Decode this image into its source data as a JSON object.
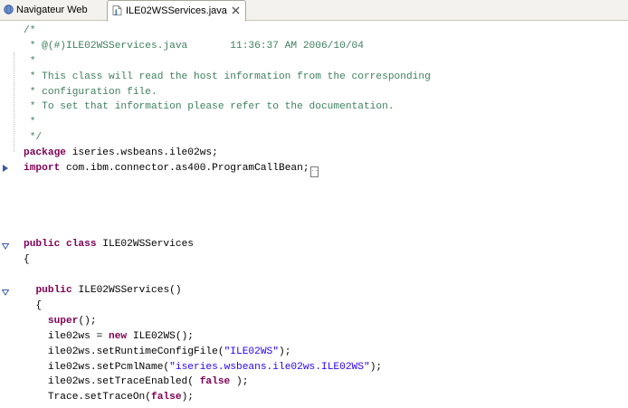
{
  "tabs": [
    {
      "label": "Navigateur Web",
      "icon": "globe-icon",
      "active": false
    },
    {
      "label": "ILE02WSServices.java",
      "icon": "java-file-icon",
      "active": true
    }
  ],
  "code": {
    "lines": [
      {
        "segs": [
          {
            "t": "/*",
            "c": "cm"
          }
        ]
      },
      {
        "segs": [
          {
            "t": " * @(#)ILE02WSServices.java       11:36:37 AM 2006/10/04",
            "c": "cm"
          }
        ]
      },
      {
        "segs": [
          {
            "t": " *",
            "c": "cm"
          }
        ]
      },
      {
        "segs": [
          {
            "t": " * This class will read the host information from the corresponding",
            "c": "cm"
          }
        ]
      },
      {
        "segs": [
          {
            "t": " * configuration file.",
            "c": "cm"
          }
        ]
      },
      {
        "segs": [
          {
            "t": " * To set that information please refer to the documentation.",
            "c": "cm"
          }
        ]
      },
      {
        "segs": [
          {
            "t": " *",
            "c": "cm"
          }
        ]
      },
      {
        "segs": [
          {
            "t": " */",
            "c": "cm"
          }
        ]
      },
      {
        "segs": [
          {
            "t": "package",
            "c": "kw"
          },
          {
            "t": " iseries.wsbeans.ile02ws;",
            "c": ""
          }
        ]
      },
      {
        "segs": [
          {
            "t": "import",
            "c": "kw"
          },
          {
            "t": " com.ibm.connector.as400.ProgramCallBean;",
            "c": ""
          }
        ],
        "collapsed": true
      },
      {
        "segs": []
      },
      {
        "segs": []
      },
      {
        "segs": []
      },
      {
        "segs": []
      },
      {
        "segs": [
          {
            "t": "public class",
            "c": "kw"
          },
          {
            "t": " ILE02WSServices",
            "c": ""
          }
        ]
      },
      {
        "segs": [
          {
            "t": "{",
            "c": ""
          }
        ]
      },
      {
        "segs": []
      },
      {
        "segs": [
          {
            "t": "  ",
            "c": ""
          },
          {
            "t": "public",
            "c": "kw"
          },
          {
            "t": " ILE02WSServices()",
            "c": ""
          }
        ]
      },
      {
        "segs": [
          {
            "t": "  {",
            "c": ""
          }
        ]
      },
      {
        "segs": [
          {
            "t": "    ",
            "c": ""
          },
          {
            "t": "super",
            "c": "kw"
          },
          {
            "t": "();",
            "c": ""
          }
        ]
      },
      {
        "segs": [
          {
            "t": "    ile02ws = ",
            "c": ""
          },
          {
            "t": "new",
            "c": "kw"
          },
          {
            "t": " ILE02WS();",
            "c": ""
          }
        ]
      },
      {
        "segs": [
          {
            "t": "    ile02ws.setRuntimeConfigFile(",
            "c": ""
          },
          {
            "t": "\"ILE02WS\"",
            "c": "str"
          },
          {
            "t": ");",
            "c": ""
          }
        ]
      },
      {
        "segs": [
          {
            "t": "    ile02ws.setPcmlName(",
            "c": ""
          },
          {
            "t": "\"iseries.wsbeans.ile02ws.ILE02WS\"",
            "c": "str"
          },
          {
            "t": ");",
            "c": ""
          }
        ]
      },
      {
        "segs": [
          {
            "t": "    ile02ws.setTraceEnabled( ",
            "c": ""
          },
          {
            "t": "false",
            "c": "kw"
          },
          {
            "t": " );",
            "c": ""
          }
        ]
      },
      {
        "segs": [
          {
            "t": "    Trace.setTraceOn(",
            "c": ""
          },
          {
            "t": "false",
            "c": "kw"
          },
          {
            "t": ");",
            "c": ""
          }
        ]
      }
    ]
  },
  "colors": {
    "comment": "#3f7f5f",
    "keyword": "#7f0055",
    "string": "#2a00ff"
  }
}
